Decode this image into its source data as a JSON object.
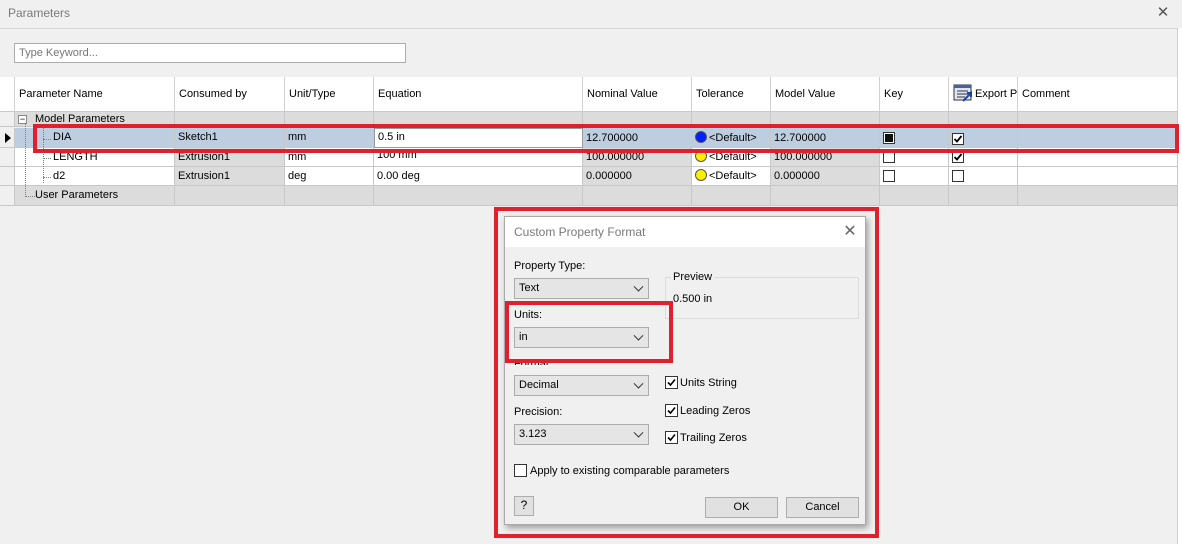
{
  "window": {
    "title": "Parameters",
    "close_glyph": "✕"
  },
  "search": {
    "placeholder": "Type Keyword..."
  },
  "grid": {
    "headers": {
      "name": "Parameter Name",
      "consumed": "Consumed by",
      "unit": "Unit/Type",
      "equation": "Equation",
      "nominal": "Nominal Value",
      "tolerance": "Tolerance",
      "model": "Model Value",
      "key": "Key",
      "export": "Export P",
      "comment": "Comment"
    },
    "groups": {
      "model": "Model Parameters",
      "user": "User Parameters"
    },
    "rows": [
      {
        "name": "DIA",
        "consumed": "Sketch1",
        "unit": "mm",
        "equation": "0.5 in",
        "nominal": "12.700000",
        "tolerance": "<Default>",
        "tol_color": "#0020ff",
        "model": "12.700000",
        "key": "filled",
        "export": "checked"
      },
      {
        "name": "LENGTH",
        "consumed": "Extrusion1",
        "unit": "mm",
        "equation": "100 mm",
        "nominal": "100.000000",
        "tolerance": "<Default>",
        "tol_color": "#ffee00",
        "model": "100.000000",
        "key": "empty",
        "export": "checked"
      },
      {
        "name": "d2",
        "consumed": "Extrusion1",
        "unit": "deg",
        "equation": "0.00 deg",
        "nominal": "0.000000",
        "tolerance": "<Default>",
        "tol_color": "#ffee00",
        "model": "0.000000",
        "key": "empty",
        "export": "empty"
      }
    ]
  },
  "dialog": {
    "title": "Custom Property Format",
    "close_glyph": "✕",
    "property_type_label": "Property Type:",
    "property_type_value": "Text",
    "preview_label": "Preview",
    "preview_value": "0.500 in",
    "units_label": "Units:",
    "units_value": "in",
    "format_label": "Format:",
    "format_value": "Decimal",
    "precision_label": "Precision:",
    "precision_value": "3.123",
    "units_string_label": "Units String",
    "leading_zeros_label": "Leading Zeros",
    "trailing_zeros_label": "Trailing Zeros",
    "apply_label": "Apply to existing comparable parameters",
    "help_glyph": "?",
    "ok_label": "OK",
    "cancel_label": "Cancel",
    "units_string_checked": true,
    "leading_zeros_checked": true,
    "trailing_zeros_checked": true,
    "apply_checked": false
  },
  "annotation_color": "#e0202a"
}
